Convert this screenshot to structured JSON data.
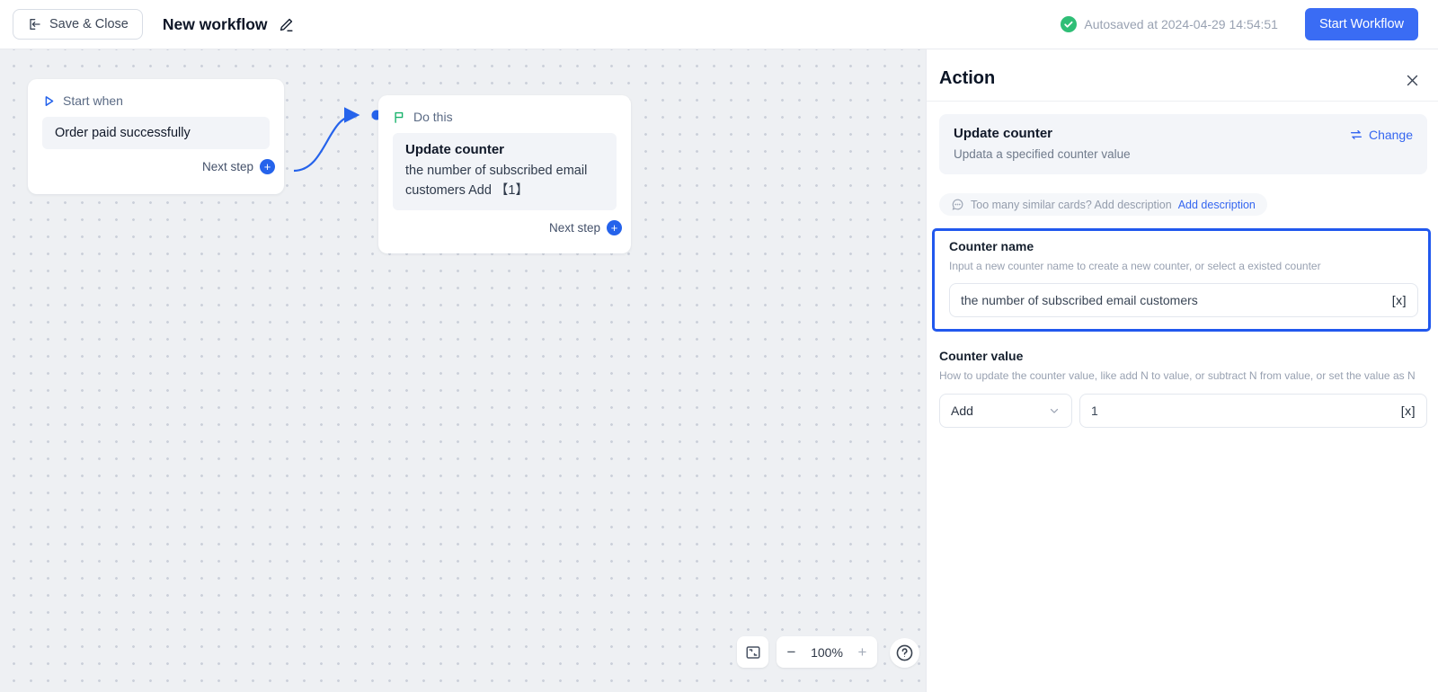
{
  "topbar": {
    "save_close_label": "Save & Close",
    "workflow_title": "New workflow",
    "autosave_status": "Autosaved at 2024-04-29 14:54:51",
    "start_workflow_label": "Start Workflow"
  },
  "canvas": {
    "start_card": {
      "header": "Start when",
      "trigger": "Order paid successfully",
      "next_step_label": "Next step",
      "plus": "+"
    },
    "do_card": {
      "header": "Do this",
      "action_title": "Update counter",
      "action_description": "the number of subscribed email customers Add 【1】",
      "next_step_label": "Next step",
      "plus": "+"
    },
    "controls": {
      "zoom_out": "−",
      "zoom_level": "100%",
      "zoom_in": "+"
    }
  },
  "panel": {
    "title": "Action",
    "summary": {
      "title": "Update counter",
      "subtitle": "Updata a specified counter value",
      "change_label": "Change"
    },
    "description_hint": {
      "text": "Too many similar cards? Add description",
      "link": "Add description"
    },
    "counter_name": {
      "label": "Counter name",
      "hint": "Input a new counter name to create a new counter, or select a existed counter",
      "value": "the number of subscribed email customers",
      "variable_button": "[x]"
    },
    "counter_value": {
      "label": "Counter value",
      "hint": "How to update the counter value, like add N to value, or subtract N from value, or set the value as N",
      "operation": "Add",
      "value": "1",
      "variable_button": "[x]"
    }
  },
  "colors": {
    "accent_blue": "#2563eb",
    "button_blue": "#3a6cf4",
    "link_blue": "#3566f0",
    "success_green": "#2fbe76",
    "flag_green": "#17b26a",
    "highlight_border": "#2158ee",
    "canvas_bg": "#eef0f3"
  }
}
